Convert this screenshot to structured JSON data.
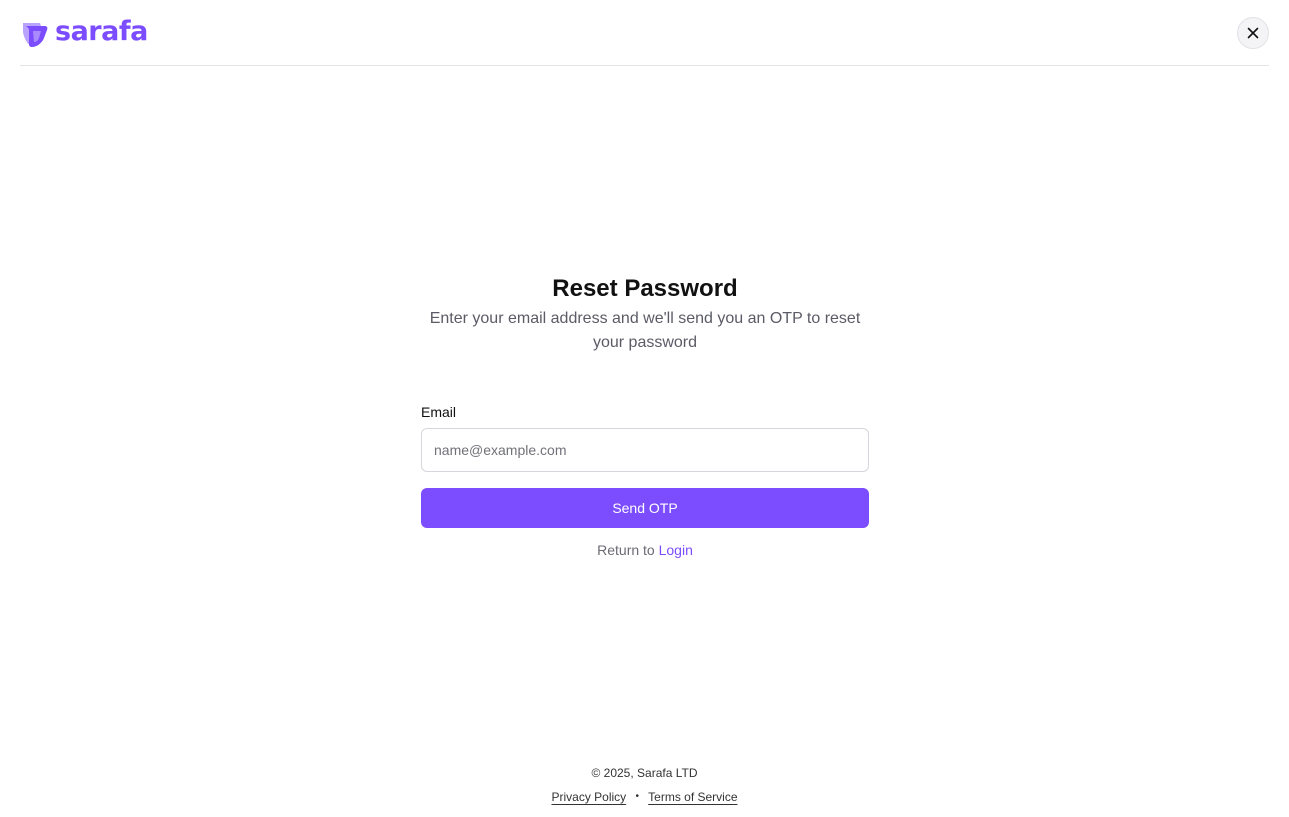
{
  "brand": {
    "name": "sarafa",
    "accent_color": "#7c4dff",
    "logo_icon": "sarafa-logo-mark"
  },
  "header": {
    "close_icon": "close-icon"
  },
  "form": {
    "title": "Reset Password",
    "subtitle": "Enter your email address and we'll send you an OTP to reset your password",
    "email_label": "Email",
    "email_value": "",
    "email_placeholder": "name@example.com",
    "submit_label": "Send OTP",
    "return_prefix": "Return to",
    "return_link": "Login"
  },
  "footer": {
    "copyright": "© 2025, Sarafa LTD",
    "privacy": "Privacy Policy",
    "separator": "•",
    "terms": "Terms of Service"
  }
}
